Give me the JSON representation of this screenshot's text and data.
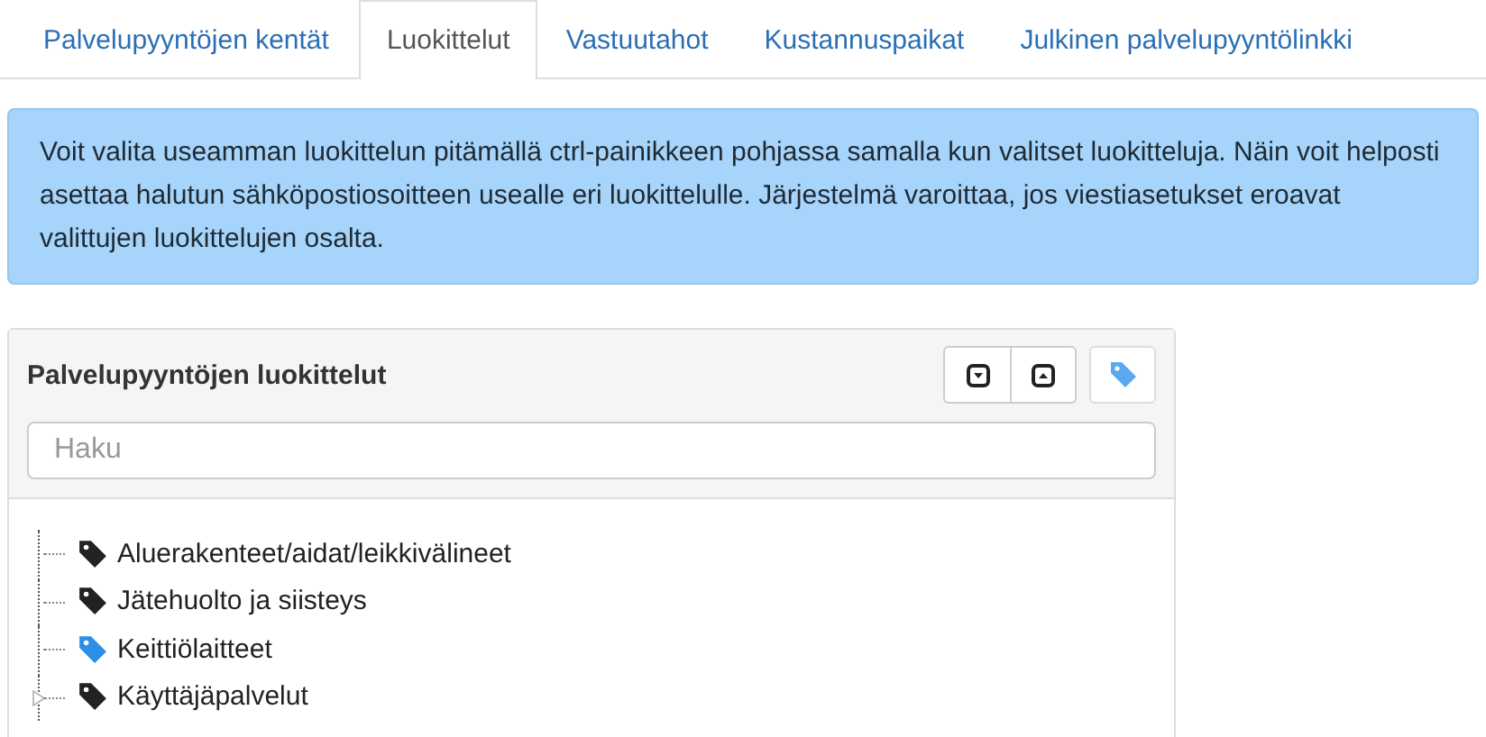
{
  "tabs": [
    {
      "label": "Palvelupyyntöjen kentät",
      "selected": false
    },
    {
      "label": "Luokittelut",
      "selected": true
    },
    {
      "label": "Vastuutahot",
      "selected": false
    },
    {
      "label": "Kustannuspaikat",
      "selected": false
    },
    {
      "label": "Julkinen palvelupyyntölinkki",
      "selected": false
    }
  ],
  "info": "Voit valita useamman luokittelun pitämällä ctrl-painikkeen pohjassa samalla kun valitset luokitteluja. Näin voit helposti asettaa halutun sähköpostiosoitteen usealle eri luokittelulle. Järjestelmä varoittaa, jos viestiasetukset eroavat valittujen luokittelujen osalta.",
  "panel": {
    "title": "Palvelupyyntöjen luokittelut",
    "search": {
      "placeholder": "Haku"
    },
    "tree": [
      {
        "label": "Aluerakenteet/aidat/leikkivälineet",
        "color": "#222222",
        "kind": "leaf"
      },
      {
        "label": "Jätehuolto ja siisteys",
        "color": "#222222",
        "kind": "leaf"
      },
      {
        "label": "Keittiölaitteet",
        "color": "#2b8fe8",
        "kind": "leaf"
      },
      {
        "label": "Käyttäjäpalvelut",
        "color": "#222222",
        "kind": "collapsed"
      }
    ]
  }
}
